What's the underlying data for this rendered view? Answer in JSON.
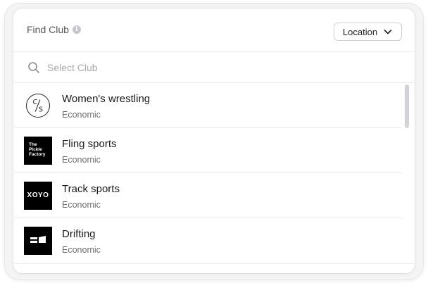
{
  "header": {
    "title": "Find Club",
    "info_icon": "info-icon",
    "location_button": "Location"
  },
  "search": {
    "placeholder": "Select Club",
    "icon": "search-icon"
  },
  "clubs": [
    {
      "name": "Women's wrestling",
      "subtitle": "Economic",
      "logo": "cs-circle-logo",
      "logo_text": "C/S"
    },
    {
      "name": "Fling sports",
      "subtitle": "Economic",
      "logo": "pickle-factory-logo",
      "logo_text": "The Pickle Factory"
    },
    {
      "name": "Track sports",
      "subtitle": "Economic",
      "logo": "xoyo-logo",
      "logo_text": "XOYO"
    },
    {
      "name": "Drifting",
      "subtitle": "Economic",
      "logo": "block-logo"
    }
  ],
  "colors": {
    "text_primary": "#1a1a1a",
    "text_secondary": "#6b6e75",
    "border": "#ececee",
    "placeholder": "#a8aab0"
  }
}
